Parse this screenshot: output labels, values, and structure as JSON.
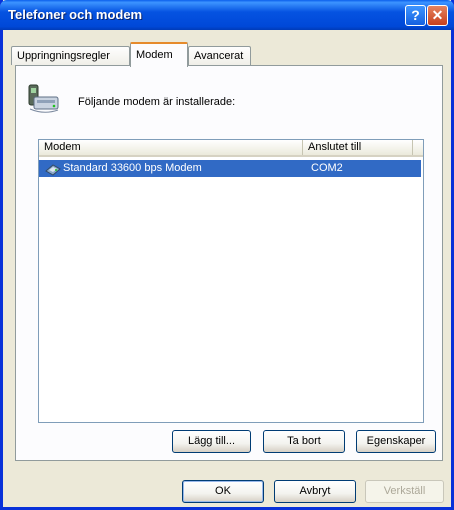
{
  "window": {
    "title": "Telefoner och modem",
    "help_button": "?",
    "close_button": "✕"
  },
  "tabs": [
    {
      "label": "Uppringningsregler",
      "active": false
    },
    {
      "label": "Modem",
      "active": true
    },
    {
      "label": "Avancerat",
      "active": false
    }
  ],
  "modem_tab": {
    "intro": "Följande modem är installerade:",
    "columns": [
      "Modem",
      "Anslutet till"
    ],
    "rows": [
      {
        "modem": "Standard 33600 bps Modem",
        "port": "COM2",
        "selected": true
      }
    ],
    "buttons": {
      "add": "Lägg till...",
      "remove": "Ta bort",
      "properties": "Egenskaper"
    }
  },
  "footer": {
    "ok": "OK",
    "cancel": "Avbryt",
    "apply": "Verkställ"
  },
  "colors": {
    "titlebar": "#0054e3",
    "selection": "#316ac5",
    "tab_accent": "#e68b2c",
    "dialog_bg": "#ece9d8"
  },
  "icons": {
    "intro": "phone-modem-icon",
    "row": "modem-icon"
  }
}
